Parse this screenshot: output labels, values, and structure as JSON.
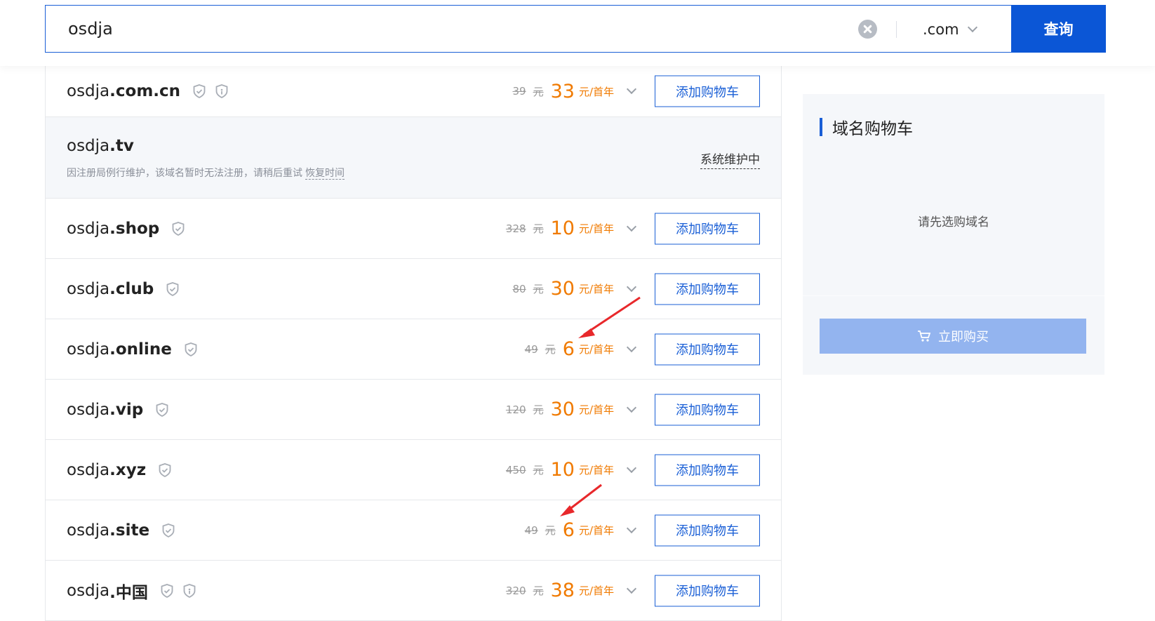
{
  "search": {
    "value": "osdja",
    "tld": ".com",
    "query_label": "查询"
  },
  "list": {
    "rows": [
      {
        "sld": "osdja",
        "tld": ".com.cn",
        "orig": "39",
        "price": "33",
        "cart": "添加购物车"
      },
      {
        "sld": "osdja",
        "tld": ".tv",
        "note": "因注册局例行维护，该域名暂时无法注册，请稍后重试",
        "note_link": "恢复时间",
        "status": "系统维护中"
      },
      {
        "sld": "osdja",
        "tld": ".shop",
        "orig": "328",
        "price": "10",
        "cart": "添加购物车"
      },
      {
        "sld": "osdja",
        "tld": ".club",
        "orig": "80",
        "price": "30",
        "cart": "添加购物车"
      },
      {
        "sld": "osdja",
        "tld": ".online",
        "orig": "49",
        "price": "6",
        "cart": "添加购物车"
      },
      {
        "sld": "osdja",
        "tld": ".vip",
        "orig": "120",
        "price": "30",
        "cart": "添加购物车"
      },
      {
        "sld": "osdja",
        "tld": ".xyz",
        "orig": "450",
        "price": "10",
        "cart": "添加购物车"
      },
      {
        "sld": "osdja",
        "tld": ".site",
        "orig": "49",
        "price": "6",
        "cart": "添加购物车"
      },
      {
        "sld": "osdja",
        "tld": ".中国",
        "orig": "320",
        "price": "38",
        "cart": "添加购物车"
      }
    ],
    "orig_unit": "元",
    "price_unit": "元/首年"
  },
  "cart": {
    "title": "域名购物车",
    "empty_text": "请先选购域名",
    "buy_label": "立即购买"
  },
  "colors": {
    "primary": "#0b56d6",
    "price": "#f07a00",
    "annotation": "#e8282b"
  }
}
